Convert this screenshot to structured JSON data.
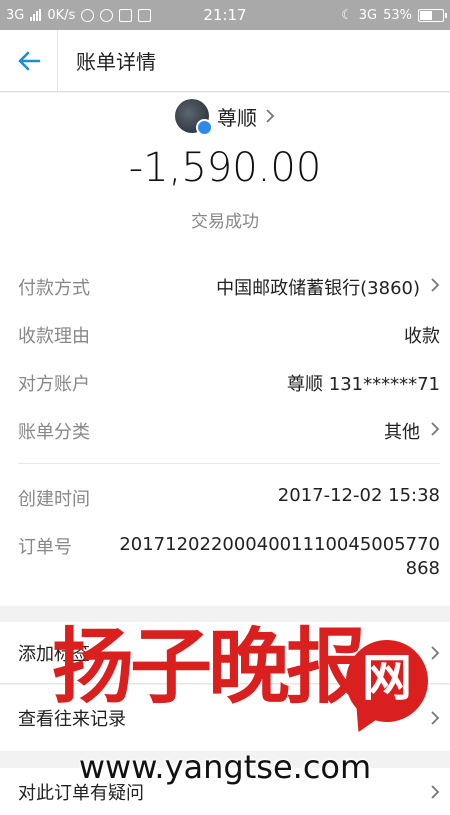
{
  "status_bar": {
    "network_left": "3G",
    "speed": "0K/s",
    "time": "21:17",
    "network_right": "3G",
    "battery": "53%",
    "battery_level": 0.53
  },
  "header": {
    "title": "账单详情",
    "back_icon": "arrow-left-icon"
  },
  "payee": {
    "name": "尊顺"
  },
  "amount": "-1,590.00",
  "status": "交易成功",
  "details": [
    {
      "label": "付款方式",
      "value": "中国邮政储蓄银行(3860)",
      "has_arrow": true
    },
    {
      "label": "收款理由",
      "value": "收款",
      "has_arrow": false
    },
    {
      "label": "对方账户",
      "value": "尊顺 131******71",
      "has_arrow": false
    },
    {
      "label": "账单分类",
      "value": "其他",
      "has_arrow": true
    }
  ],
  "meta": [
    {
      "label": "创建时间",
      "value": "2017-12-02 15:38"
    },
    {
      "label": "订单号",
      "value": "2017120220004001110045005770",
      "value_line2": "868"
    }
  ],
  "actions": [
    {
      "label": "添加标签"
    },
    {
      "label": "查看往来记录"
    },
    {
      "label": "对此订单有疑问"
    }
  ],
  "watermark": {
    "title": "扬子晚报",
    "badge": "网",
    "url": "www.yangtse.com"
  },
  "colors": {
    "accent": "#1a8fd6",
    "watermark_red": "#d9201e",
    "verify_blue": "#2e8ae6"
  }
}
